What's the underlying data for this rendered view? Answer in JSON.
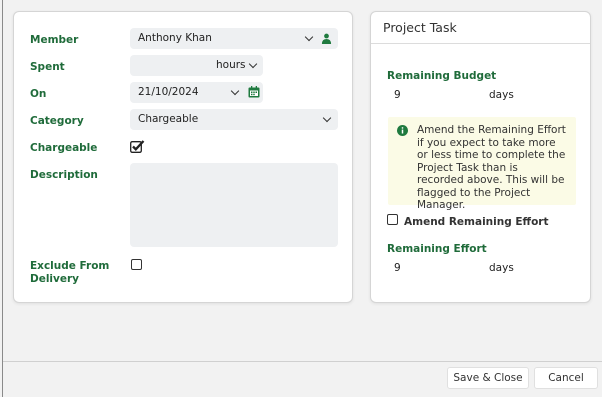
{
  "form": {
    "member_label": "Member",
    "member_value": "Anthony Khan",
    "spent_label": "Spent",
    "spent_unit": "hours",
    "on_label": "On",
    "on_value": "21/10/2024",
    "category_label": "Category",
    "category_value": "Chargeable",
    "chargeable_label": "Chargeable",
    "chargeable_checked": true,
    "description_label": "Description",
    "exclude_label_line1": "Exclude From",
    "exclude_label_line2": "Delivery",
    "exclude_checked": false
  },
  "project_task": {
    "title": "Project Task",
    "remaining_budget_label": "Remaining Budget",
    "remaining_budget_value": "9",
    "remaining_budget_unit": "days",
    "info_text": "Amend the Remaining Effort if you expect to take more or less time to complete the Project Task than is recorded above. This will be flagged to the Project Manager.",
    "amend_label": "Amend Remaining Effort",
    "amend_checked": false,
    "remaining_effort_label": "Remaining Effort",
    "remaining_effort_value": "9",
    "remaining_effort_unit": "days"
  },
  "footer": {
    "save_close_label": "Save & Close",
    "cancel_label": "Cancel"
  },
  "colors": {
    "label_green": "#1f6b3a",
    "field_bg": "#eef0f2",
    "info_bg": "#fbfbe6",
    "icon_green": "#1f7a3f"
  }
}
